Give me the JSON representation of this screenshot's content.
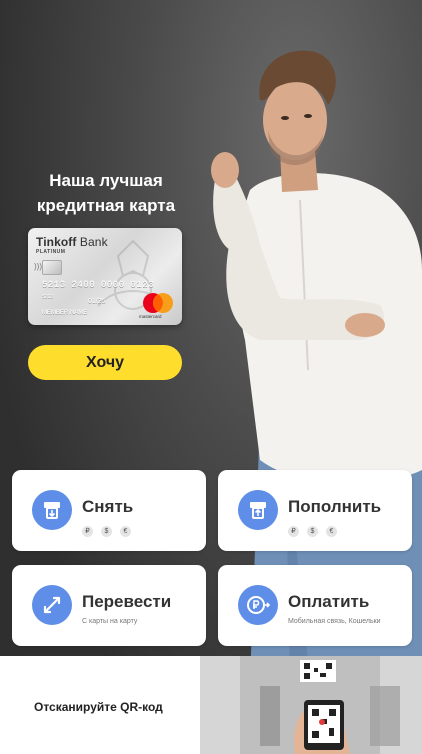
{
  "promo": {
    "title_line1": "Наша лучшая",
    "title_line2": "кредитная карта",
    "button_label": "Хочу"
  },
  "card": {
    "brand_name": "Tinkoff",
    "brand_suffix": "Bank",
    "tier": "PLATINUM",
    "number": "5213 2400 0000 0123",
    "small_number": "5213",
    "expiry": "01/25",
    "holder": "MEMBER NAME",
    "network_label": "mastercard"
  },
  "actions": [
    {
      "title": "Снять",
      "currencies": [
        "₽",
        "$",
        "€"
      ],
      "icon": "atm-withdraw-icon"
    },
    {
      "title": "Пополнить",
      "currencies": [
        "₽",
        "$",
        "€"
      ],
      "icon": "atm-deposit-icon"
    },
    {
      "title": "Перевести",
      "subtitle": "С карты на карту",
      "icon": "transfer-arrows-icon"
    },
    {
      "title": "Оплатить",
      "subtitle": "Мобильная связь, Кошельки",
      "icon": "ruble-payment-icon"
    }
  ],
  "qr": {
    "label": "Отсканируйте QR-код"
  },
  "colors": {
    "accent_yellow": "#ffdd2d",
    "icon_blue": "#5f8ee8",
    "background_dark": "#3a3a3a"
  }
}
